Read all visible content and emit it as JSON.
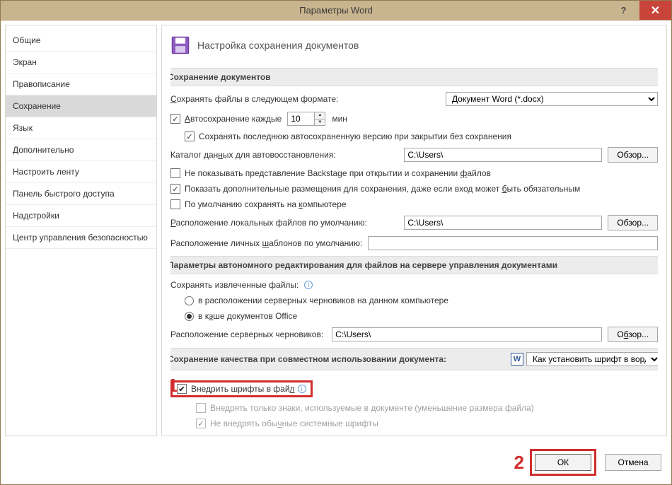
{
  "window": {
    "title": "Параметры Word",
    "help_icon": "?",
    "close_icon": "✕"
  },
  "sidebar": {
    "items": [
      {
        "label": "Общие"
      },
      {
        "label": "Экран"
      },
      {
        "label": "Правописание"
      },
      {
        "label": "Сохранение",
        "selected": true
      },
      {
        "label": "Язык"
      },
      {
        "label": "Дополнительно"
      },
      {
        "label": "Настроить ленту"
      },
      {
        "label": "Панель быстрого доступа"
      },
      {
        "label": "Надстройки"
      },
      {
        "label": "Центр управления безопасностью"
      }
    ]
  },
  "main": {
    "heading": "Настройка сохранения документов",
    "section1_title": "Сохранение документов",
    "save_format_label": "Сохранять файлы в следующем формате:",
    "save_format_value": "Документ Word (*.docx)",
    "autosave_label": "Автосохранение каждые",
    "autosave_value": "10",
    "autosave_unit": "мин",
    "keep_last_label": "Сохранять последнюю автосохраненную версию при закрытии без сохранения",
    "autorecover_label": "Каталог данных для автовосстановления:",
    "autorecover_value": "C:\\Users\\",
    "browse_label": "Обзор...",
    "no_backstage_label": "Не показывать представление Backstage при открытии и сохранении файлов",
    "show_addl_label": "Показать дополнительные размещения для сохранения, даже если вход может быть обязательным",
    "save_pc_label": "По умолчанию сохранять на компьютере",
    "local_files_label": "Расположение локальных файлов по умолчанию:",
    "local_files_value": "C:\\Users\\",
    "personal_templates_label": "Расположение личных шаблонов по умолчанию:",
    "section2_title": "Параметры автономного редактирования для файлов на сервере управления документами",
    "save_extracted_label": "Сохранять извлеченные файлы:",
    "radio1_label": "в расположении серверных черновиков на данном компьютере",
    "radio2_label": "в кэше документов Office",
    "server_drafts_label": "Расположение серверных черновиков:",
    "server_drafts_value": "C:\\Users\\",
    "section3_title": "Сохранение качества при совместном использовании документа:",
    "section3_doc": "Как установить шрифт в ворд",
    "embed_fonts_label": "Внедрить шрифты в файл",
    "embed_only_used_label": "Внедрять только знаки, используемые в документе (уменьшение размера файла)",
    "no_system_fonts_label": "Не внедрять обычные системные шрифты",
    "callout1": "1",
    "callout2": "2"
  },
  "footer": {
    "ok": "ОК",
    "cancel": "Отмена"
  }
}
